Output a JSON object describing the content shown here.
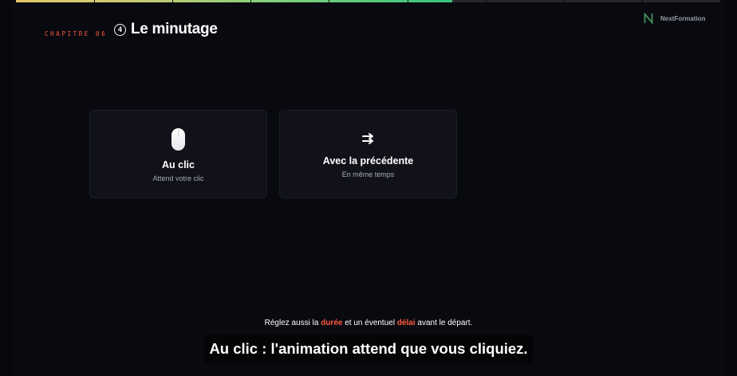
{
  "progress": {
    "fraction": 0.62,
    "segments": 9
  },
  "header": {
    "chapter_label": "CHAPITRE 06",
    "chapter_number": "4",
    "title": "Le minutage",
    "brand_name": "NextFormation"
  },
  "cards": [
    {
      "icon": "mouse-icon",
      "title": "Au clic",
      "subtitle": "Attend votre clic"
    },
    {
      "icon": "double-arrow-icon",
      "arrow_glyph": "⇉",
      "title": "Avec la précédente",
      "subtitle": "En même temps"
    }
  ],
  "hint": {
    "part1": "Réglez aussi la ",
    "highlight1": "durée",
    "part2": " et un éventuel ",
    "highlight2": "délai",
    "part3": " avant le départ."
  },
  "caption": "Au clic : l'animation attend que vous cliquiez.",
  "colors": {
    "accent": "#ff5a3c",
    "background": "#090a10",
    "card": "#111219"
  }
}
